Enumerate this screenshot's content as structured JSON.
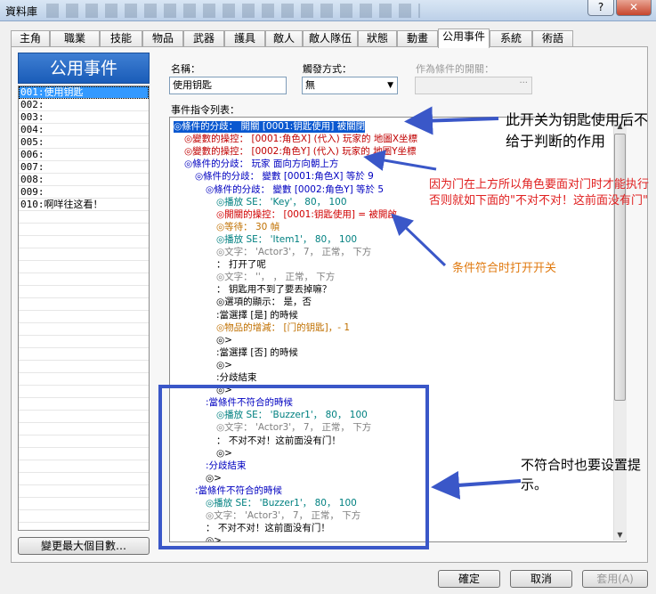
{
  "window": {
    "title": "資料庫",
    "help_label": "?",
    "close_label": "✕"
  },
  "tabs": [
    "主角",
    "職業",
    "技能",
    "物品",
    "武器",
    "護具",
    "敵人",
    "敵人隊伍",
    "狀態",
    "動畫",
    "公用事件",
    "系統",
    "術語"
  ],
  "active_tab": "公用事件",
  "left_panel": {
    "header": "公用事件",
    "items": [
      "001:使用钥匙",
      "002:",
      "003:",
      "004:",
      "005:",
      "006:",
      "007:",
      "008:",
      "009:",
      "010:啊咩往这看！"
    ],
    "selected_index": 0,
    "change_max_button": "變更最大個目數…"
  },
  "form": {
    "name_label": "名稱：",
    "name_value": "使用钥匙",
    "trigger_label": "觸發方式：",
    "trigger_value": "無",
    "condition_switch_label": "作為條件的開關：",
    "condition_switch_value": "",
    "command_list_label": "事件指令列表："
  },
  "commands": [
    {
      "text": "◎條件的分歧：  開關  [0001:钥匙使用] 被關閉",
      "color": "#0000c0",
      "indent": 0,
      "selected": true
    },
    {
      "text": "◎變數的操控：  [0001:角色X] (代入) 玩家的 地圖X坐標",
      "color": "#c00000",
      "indent": 1
    },
    {
      "text": "◎變數的操控：  [0002:角色Y] (代入) 玩家的 地圖Y坐標",
      "color": "#c00000",
      "indent": 1
    },
    {
      "text": "◎條件的分歧： 玩家  面向方向朝上方",
      "color": "#0000c0",
      "indent": 1
    },
    {
      "text": "◎條件的分歧：  變數  [0001:角色X]  等於 9",
      "color": "#0000c0",
      "indent": 2
    },
    {
      "text": "◎條件的分歧：  變數  [0002:角色Y]  等於 5",
      "color": "#0000c0",
      "indent": 3
    },
    {
      "text": "◎播放  SE： 'Key'，  80，  100",
      "color": "#008080",
      "indent": 4
    },
    {
      "text": "◎開關的操控：  [0001:钥匙使用]  = 被開啟",
      "color": "#d00000",
      "indent": 4
    },
    {
      "text": "◎等待：  30 幀",
      "color": "#c07000",
      "indent": 4
    },
    {
      "text": "◎播放  SE： 'Item1'，  80，  100",
      "color": "#008080",
      "indent": 4
    },
    {
      "text": "◎文字： 'Actor3'，  7，  正常，  下方",
      "color": "#808080",
      "indent": 4
    },
    {
      "text": "        ：      打开了呢",
      "color": "#000000",
      "indent": 4
    },
    {
      "text": "◎文字： ''，  ，  正常，  下方",
      "color": "#808080",
      "indent": 4
    },
    {
      "text": "        ：      钥匙用不到了要丟掉嘛？",
      "color": "#000000",
      "indent": 4
    },
    {
      "text": "◎選項的顯示：  是，否",
      "color": "#000000",
      "indent": 4
    },
    {
      "text": "  :當選擇  [是]  的時候",
      "color": "#000000",
      "indent": 4
    },
    {
      "text": "    ◎物品的增減：  [门的钥匙]，- 1",
      "color": "#c07000",
      "indent": 4
    },
    {
      "text": "    ◎>",
      "color": "#000000",
      "indent": 4
    },
    {
      "text": "  :當選擇  [否]  的時候",
      "color": "#000000",
      "indent": 4
    },
    {
      "text": "    ◎>",
      "color": "#000000",
      "indent": 4
    },
    {
      "text": "  :分歧結束",
      "color": "#000000",
      "indent": 4
    },
    {
      "text": "◎>",
      "color": "#000000",
      "indent": 4
    },
    {
      "text": ":當條件不符合的時候",
      "color": "#0000c0",
      "indent": 3
    },
    {
      "text": "◎播放  SE： 'Buzzer1'，  80，  100",
      "color": "#008080",
      "indent": 4
    },
    {
      "text": "◎文字： 'Actor3'，  7，  正常，  下方",
      "color": "#808080",
      "indent": 4
    },
    {
      "text": "        ：      不对不对！这前面没有门！",
      "color": "#000000",
      "indent": 4
    },
    {
      "text": "◎>",
      "color": "#000000",
      "indent": 4
    },
    {
      "text": ":分歧結束",
      "color": "#0000c0",
      "indent": 3
    },
    {
      "text": "◎>",
      "color": "#000000",
      "indent": 3
    },
    {
      "text": ":當條件不符合的時候",
      "color": "#0000c0",
      "indent": 2
    },
    {
      "text": "◎播放  SE： 'Buzzer1'，  80，  100",
      "color": "#008080",
      "indent": 3
    },
    {
      "text": "◎文字： 'Actor3'，  7，  正常，  下方",
      "color": "#808080",
      "indent": 3
    },
    {
      "text": "  ：      不对不对！这前面没有门！",
      "color": "#000000",
      "indent": 3
    },
    {
      "text": "◎>",
      "color": "#000000",
      "indent": 3
    }
  ],
  "annotations": {
    "note1": "此开关为钥匙使用后不给于判断的作用",
    "note2": "因为门在上方所以角色要面对门时才能执行否则就如下面的\"不对不对！这前面没有门\"",
    "note3": "条件符合时打开开关",
    "note4": "不符合时也要设置提示。"
  },
  "footer": {
    "ok": "確定",
    "cancel": "取消",
    "apply": "套用(A)"
  },
  "colors": {
    "accent": "#3a57c8",
    "annotation_red": "#e02020",
    "annotation_orange": "#e07a10"
  }
}
